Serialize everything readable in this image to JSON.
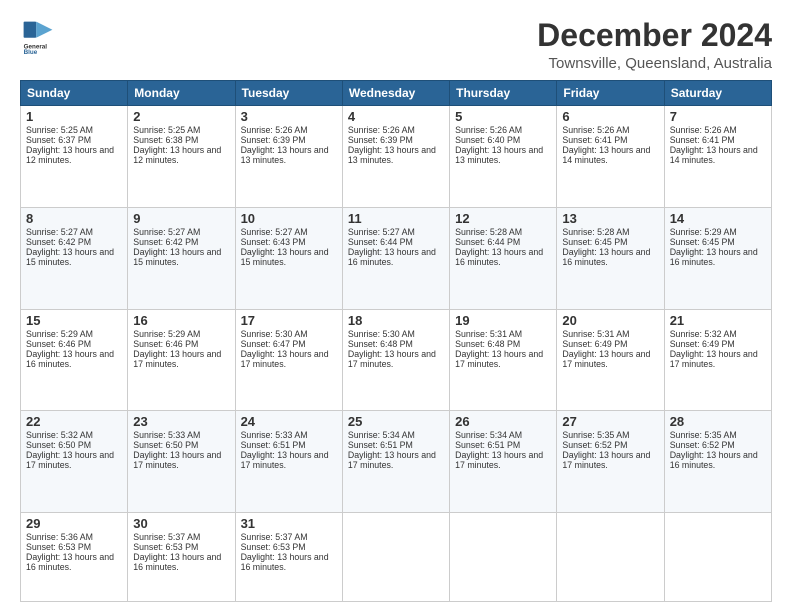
{
  "header": {
    "logo_line1": "General",
    "logo_line2": "Blue",
    "title": "December 2024",
    "subtitle": "Townsville, Queensland, Australia"
  },
  "calendar": {
    "days_of_week": [
      "Sunday",
      "Monday",
      "Tuesday",
      "Wednesday",
      "Thursday",
      "Friday",
      "Saturday"
    ],
    "weeks": [
      [
        {
          "day": "1",
          "sunrise": "5:25 AM",
          "sunset": "6:37 PM",
          "daylight": "13 hours and 12 minutes."
        },
        {
          "day": "2",
          "sunrise": "5:25 AM",
          "sunset": "6:38 PM",
          "daylight": "13 hours and 12 minutes."
        },
        {
          "day": "3",
          "sunrise": "5:26 AM",
          "sunset": "6:39 PM",
          "daylight": "13 hours and 13 minutes."
        },
        {
          "day": "4",
          "sunrise": "5:26 AM",
          "sunset": "6:39 PM",
          "daylight": "13 hours and 13 minutes."
        },
        {
          "day": "5",
          "sunrise": "5:26 AM",
          "sunset": "6:40 PM",
          "daylight": "13 hours and 13 minutes."
        },
        {
          "day": "6",
          "sunrise": "5:26 AM",
          "sunset": "6:41 PM",
          "daylight": "13 hours and 14 minutes."
        },
        {
          "day": "7",
          "sunrise": "5:26 AM",
          "sunset": "6:41 PM",
          "daylight": "13 hours and 14 minutes."
        }
      ],
      [
        {
          "day": "8",
          "sunrise": "5:27 AM",
          "sunset": "6:42 PM",
          "daylight": "13 hours and 15 minutes."
        },
        {
          "day": "9",
          "sunrise": "5:27 AM",
          "sunset": "6:42 PM",
          "daylight": "13 hours and 15 minutes."
        },
        {
          "day": "10",
          "sunrise": "5:27 AM",
          "sunset": "6:43 PM",
          "daylight": "13 hours and 15 minutes."
        },
        {
          "day": "11",
          "sunrise": "5:27 AM",
          "sunset": "6:44 PM",
          "daylight": "13 hours and 16 minutes."
        },
        {
          "day": "12",
          "sunrise": "5:28 AM",
          "sunset": "6:44 PM",
          "daylight": "13 hours and 16 minutes."
        },
        {
          "day": "13",
          "sunrise": "5:28 AM",
          "sunset": "6:45 PM",
          "daylight": "13 hours and 16 minutes."
        },
        {
          "day": "14",
          "sunrise": "5:29 AM",
          "sunset": "6:45 PM",
          "daylight": "13 hours and 16 minutes."
        }
      ],
      [
        {
          "day": "15",
          "sunrise": "5:29 AM",
          "sunset": "6:46 PM",
          "daylight": "13 hours and 16 minutes."
        },
        {
          "day": "16",
          "sunrise": "5:29 AM",
          "sunset": "6:46 PM",
          "daylight": "13 hours and 17 minutes."
        },
        {
          "day": "17",
          "sunrise": "5:30 AM",
          "sunset": "6:47 PM",
          "daylight": "13 hours and 17 minutes."
        },
        {
          "day": "18",
          "sunrise": "5:30 AM",
          "sunset": "6:48 PM",
          "daylight": "13 hours and 17 minutes."
        },
        {
          "day": "19",
          "sunrise": "5:31 AM",
          "sunset": "6:48 PM",
          "daylight": "13 hours and 17 minutes."
        },
        {
          "day": "20",
          "sunrise": "5:31 AM",
          "sunset": "6:49 PM",
          "daylight": "13 hours and 17 minutes."
        },
        {
          "day": "21",
          "sunrise": "5:32 AM",
          "sunset": "6:49 PM",
          "daylight": "13 hours and 17 minutes."
        }
      ],
      [
        {
          "day": "22",
          "sunrise": "5:32 AM",
          "sunset": "6:50 PM",
          "daylight": "13 hours and 17 minutes."
        },
        {
          "day": "23",
          "sunrise": "5:33 AM",
          "sunset": "6:50 PM",
          "daylight": "13 hours and 17 minutes."
        },
        {
          "day": "24",
          "sunrise": "5:33 AM",
          "sunset": "6:51 PM",
          "daylight": "13 hours and 17 minutes."
        },
        {
          "day": "25",
          "sunrise": "5:34 AM",
          "sunset": "6:51 PM",
          "daylight": "13 hours and 17 minutes."
        },
        {
          "day": "26",
          "sunrise": "5:34 AM",
          "sunset": "6:51 PM",
          "daylight": "13 hours and 17 minutes."
        },
        {
          "day": "27",
          "sunrise": "5:35 AM",
          "sunset": "6:52 PM",
          "daylight": "13 hours and 17 minutes."
        },
        {
          "day": "28",
          "sunrise": "5:35 AM",
          "sunset": "6:52 PM",
          "daylight": "13 hours and 16 minutes."
        }
      ],
      [
        {
          "day": "29",
          "sunrise": "5:36 AM",
          "sunset": "6:53 PM",
          "daylight": "13 hours and 16 minutes."
        },
        {
          "day": "30",
          "sunrise": "5:37 AM",
          "sunset": "6:53 PM",
          "daylight": "13 hours and 16 minutes."
        },
        {
          "day": "31",
          "sunrise": "5:37 AM",
          "sunset": "6:53 PM",
          "daylight": "13 hours and 16 minutes."
        },
        null,
        null,
        null,
        null
      ]
    ]
  }
}
